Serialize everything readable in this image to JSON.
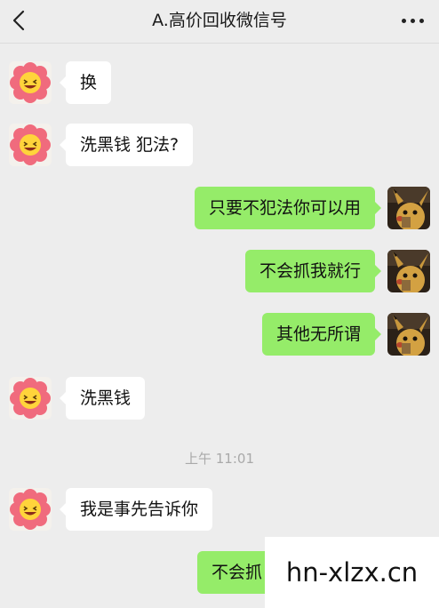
{
  "header": {
    "title": "A.高价回收微信号",
    "back_icon": "chevron-left-icon",
    "more_icon": "more-dots-icon"
  },
  "messages": [
    {
      "side": "left",
      "text": "换"
    },
    {
      "side": "left",
      "text": "洗黑钱 犯法?"
    },
    {
      "side": "right",
      "text": "只要不犯法你可以用"
    },
    {
      "side": "right",
      "text": "不会抓我就行"
    },
    {
      "side": "right",
      "text": "其他无所谓"
    },
    {
      "side": "left",
      "text": "洗黑钱"
    },
    {
      "side": "left",
      "text": "我是事先告诉你"
    },
    {
      "side": "right",
      "text": "不会抓"
    }
  ],
  "timestamp": "上午 11:01",
  "watermark": "hn-xlzx.cn",
  "colors": {
    "background": "#ededed",
    "sent_bubble": "#95ec69",
    "received_bubble": "#ffffff"
  }
}
